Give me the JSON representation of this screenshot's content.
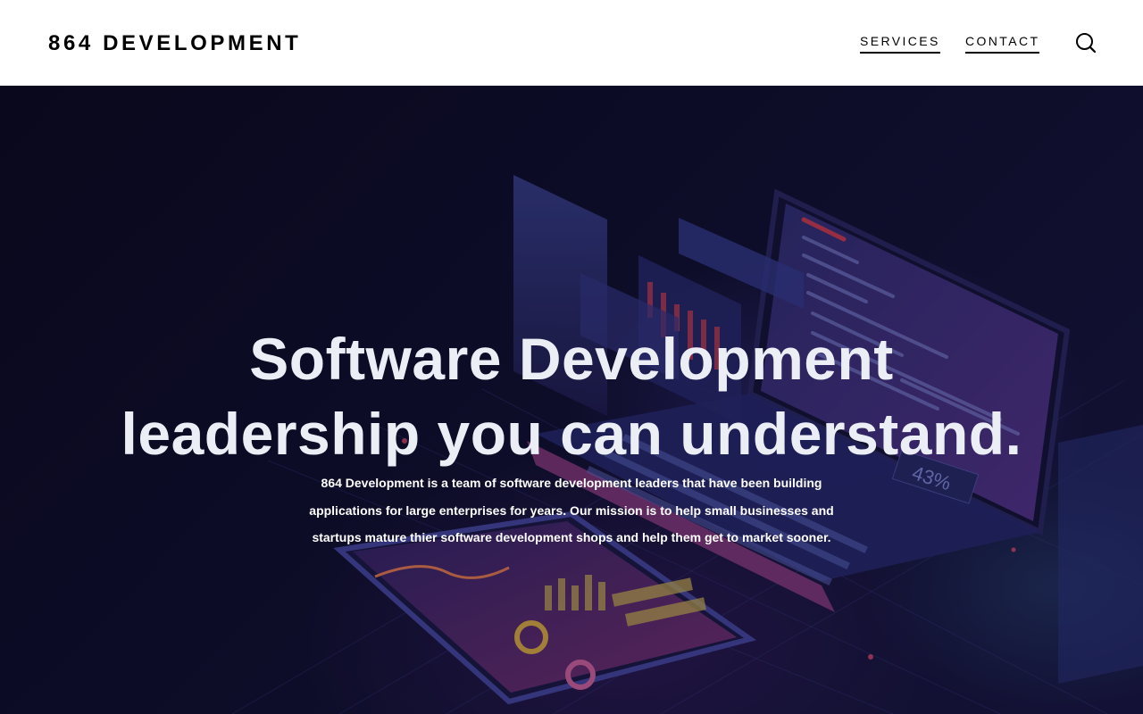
{
  "site": {
    "logo": "864 DEVELOPMENT"
  },
  "nav": {
    "items": [
      {
        "label": "SERVICES"
      },
      {
        "label": "CONTACT"
      }
    ],
    "search_icon": "search-icon"
  },
  "hero": {
    "title_line1": "Software Development",
    "title_line2": "leadership you can understand.",
    "description": "864 Development is a team of software development leaders that have been building applications for large enterprises for years. Our mission is to help small businesses and startups mature thier software development shops and help them get to market sooner.",
    "image_badge": "43%",
    "colors": {
      "background": "#0f1030",
      "title": "#eceef6",
      "accent_purple": "#7a4fd0",
      "accent_red": "#e0445a"
    }
  }
}
